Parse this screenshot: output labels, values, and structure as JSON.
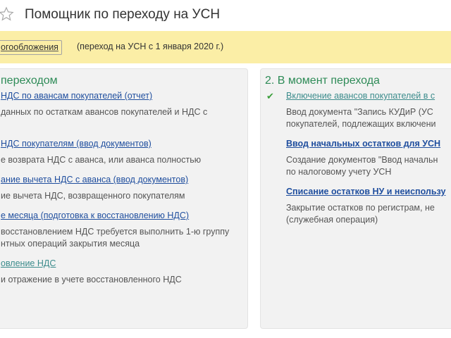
{
  "header": {
    "title": "Помощник по переходу на УСН"
  },
  "banner": {
    "regime_link": "огообложения",
    "regime_note": "(переход на УСН с 1 января 2020 г.)"
  },
  "left_panel": {
    "title": "переходом",
    "items": [
      {
        "link": "НДС по авансам покупателей (отчет)",
        "desc": [
          "данных по остаткам авансов покупателей и НДС с"
        ]
      },
      {
        "link": "НДС покупателям (ввод документов)",
        "desc": [
          "е возврата НДС с аванса, или аванса полностью"
        ]
      },
      {
        "link": "ание вычета НДС с аванса (ввод документов)",
        "desc": [
          "ие вычета НДС, возвращенного покупателям"
        ]
      },
      {
        "link": "е месяца (подготовка к восстановлению НДС)",
        "desc": [
          "восстановлением НДС требуется выполнить 1-ю группу",
          "нтных операций закрытия месяца"
        ]
      },
      {
        "link": "овление НДС",
        "desc": [
          "и отражение в учете восстановленного НДС"
        ]
      }
    ]
  },
  "right_panel": {
    "title": "2. В момент перехода",
    "items": [
      {
        "link": "Включение авансов покупателей в с",
        "desc": [
          "Ввод документа \"Запись КУДиР (УС",
          "покупателей, подлежащих включени"
        ]
      },
      {
        "link": "Ввод начальных остатков для УСН",
        "desc": [
          "Создание документов \"Ввод начальн",
          "по налоговому учету УСН"
        ]
      },
      {
        "link": "Списание остатков НУ и неиспользу",
        "desc": [
          "Закрытие остатков по  регистрам, не",
          "(служебная операция)"
        ]
      }
    ]
  }
}
